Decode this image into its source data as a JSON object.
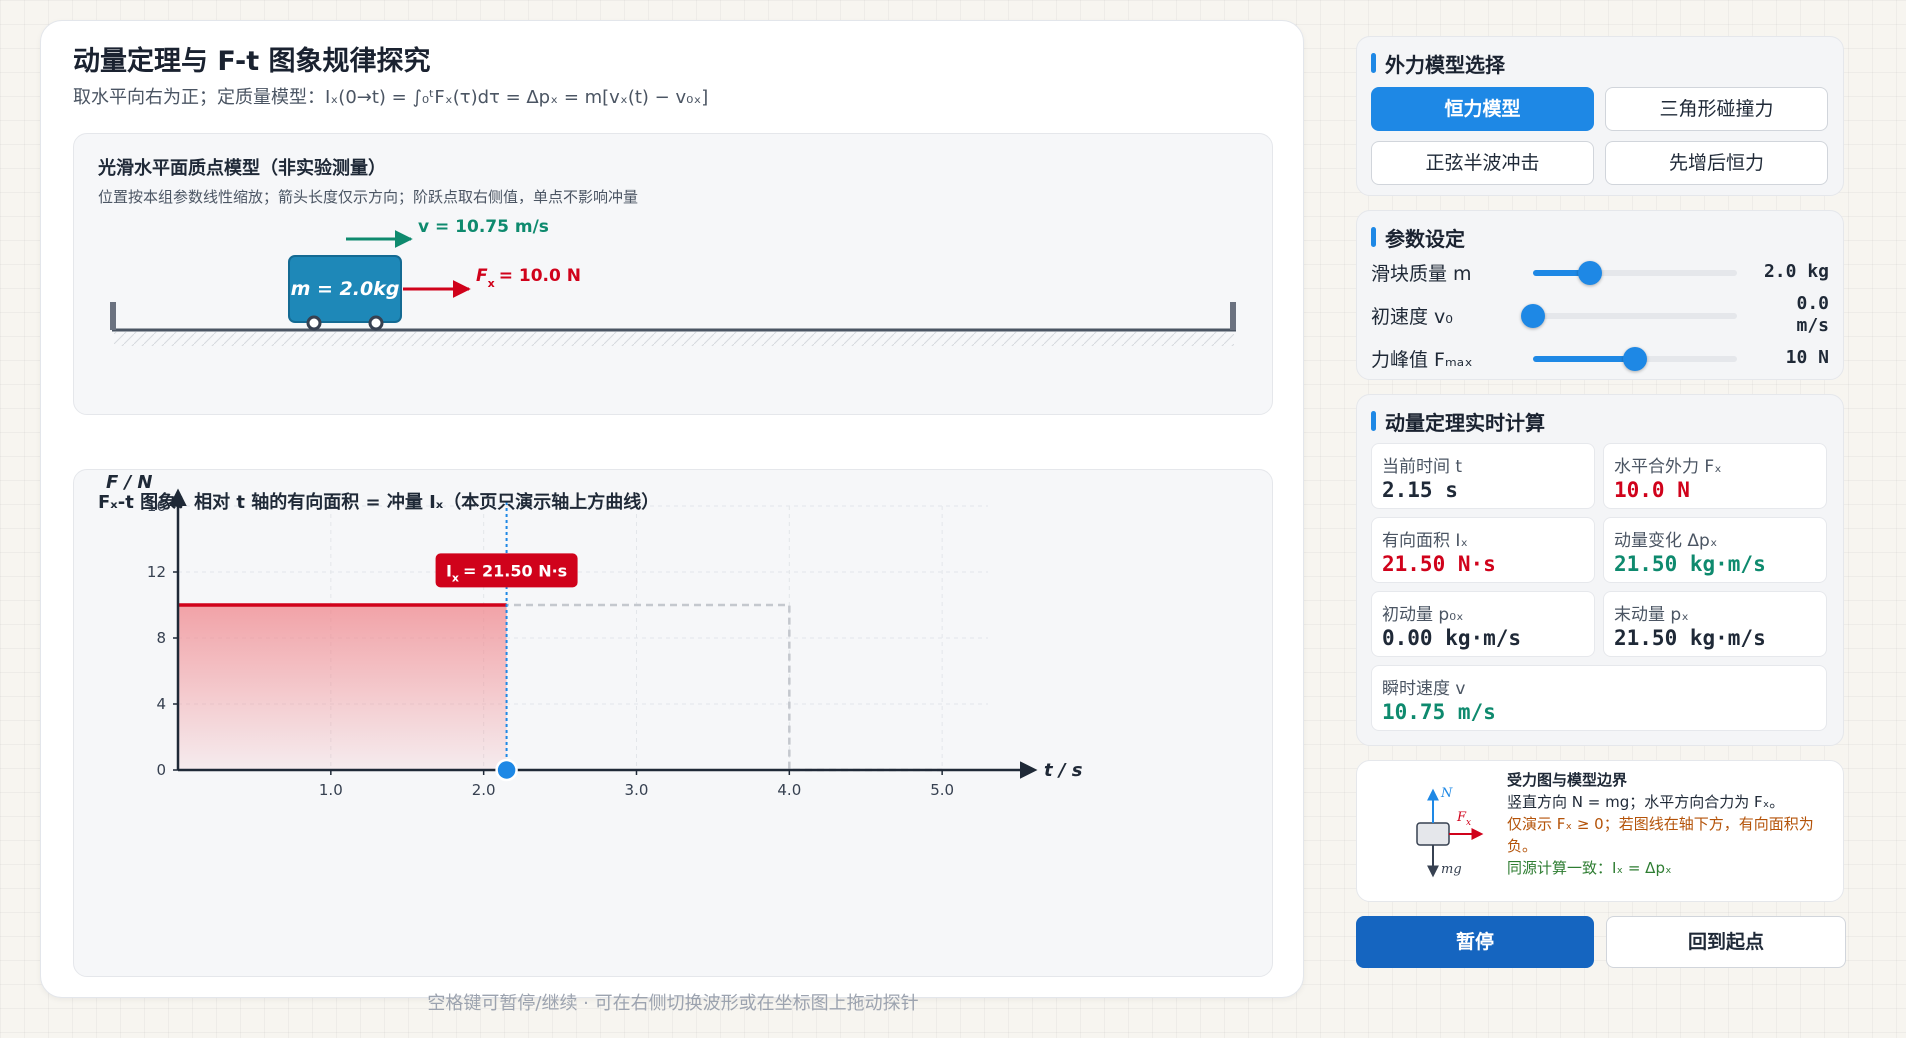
{
  "header": {
    "title": "动量定理与 F-t 图象规律探究",
    "subtitle": "取水平向右为正；定质量模型：Iₓ(0→t) = ∫₀ᵗFₓ(τ)dτ = Δpₓ = m[vₓ(t) − v₀ₓ]"
  },
  "model_panel": {
    "title": "光滑水平面质点模型（非实验测量）",
    "note": "位置按本组参数线性缩放；箭头长度仅示方向；阶跃点取右侧值，单点不影响冲量",
    "block_label": "m = 2.0kg",
    "velocity_label": "v = 10.75 m/s",
    "force_label_main": "F",
    "force_label_sub": "x",
    "force_label_value": "= 10.0 N"
  },
  "graph_panel": {
    "title": "Fₓ-t 图象：相对 t 轴的有向面积 = 冲量 Iₓ（本页只演示轴上方曲线）",
    "callout_main": "I",
    "callout_sub": "x",
    "callout_value": "= 21.50 N·s",
    "y_axis_label": "F / N",
    "x_axis_label": "t / s"
  },
  "chart_data": {
    "type": "area",
    "x_ticks": [
      "1.0",
      "2.0",
      "3.0",
      "4.0",
      "5.0"
    ],
    "y_ticks": [
      "0",
      "4",
      "8",
      "12",
      "16"
    ],
    "xlim": [
      0,
      5.3
    ],
    "ylim": [
      0,
      16
    ],
    "grid": true,
    "series": [
      {
        "x": [
          0,
          4.0,
          4.0,
          5.0
        ],
        "y": [
          10,
          10,
          0,
          0
        ]
      }
    ],
    "cursor_t": 2.15,
    "shaded_area": 21.5
  },
  "hint": "空格键可暂停/继续 · 可在右侧切换波形或在坐标图上拖动探针",
  "sidebar": {
    "model_section": {
      "title": "外力模型选择",
      "buttons": [
        "恒力模型",
        "三角形碰撞力",
        "正弦半波冲击",
        "先增后恒力"
      ],
      "active": 0
    },
    "params_section": {
      "title": "参数设定",
      "items": [
        {
          "label": "滑块质量 m",
          "value": "2.0 kg",
          "fraction": 0.28
        },
        {
          "label": "初速度 v₀",
          "value": "0.0 m/s",
          "fraction": 0.0
        },
        {
          "label": "力峰值 Fₘₐₓ",
          "value": "10 N",
          "fraction": 0.5
        }
      ]
    },
    "calc_section": {
      "title": "动量定理实时计算",
      "stats": [
        {
          "label": "当前时间 t",
          "value": "2.15 s",
          "color": "#1f2937"
        },
        {
          "label": "水平合外力 Fₓ",
          "value": "10.0 N",
          "color": "#d0021b"
        },
        {
          "label": "有向面积 Iₓ",
          "value": "21.50 N·s",
          "color": "#d0021b"
        },
        {
          "label": "动量变化 Δpₓ",
          "value": "21.50 kg·m/s",
          "color": "#0e8a6e"
        },
        {
          "label": "初动量 p₀ₓ",
          "value": "0.00 kg·m/s",
          "color": "#1f2937"
        },
        {
          "label": "末动量 pₓ",
          "value": "21.50 kg·m/s",
          "color": "#1f2937"
        },
        {
          "label": "瞬时速度 v",
          "value": "10.75 m/s",
          "color": "#0e8a6e"
        }
      ]
    },
    "fbd": {
      "title": "受力图与模型边界",
      "line1": "竖直方向 N = mg；水平方向合力为 Fₓ。",
      "line2": "仅演示 Fₓ ≥ 0；若图线在轴下方，有向面积为负。",
      "line3": "同源计算一致：Iₓ = Δpₓ",
      "label_n": "N",
      "label_f": "F",
      "label_f_sub": "x",
      "label_mg": "mg"
    },
    "pause_label": "暂停",
    "reset_label": "回到起点"
  },
  "colors": {
    "accent": "#1e88e5",
    "force": "#d0021b",
    "velocity": "#0e8a6e"
  }
}
